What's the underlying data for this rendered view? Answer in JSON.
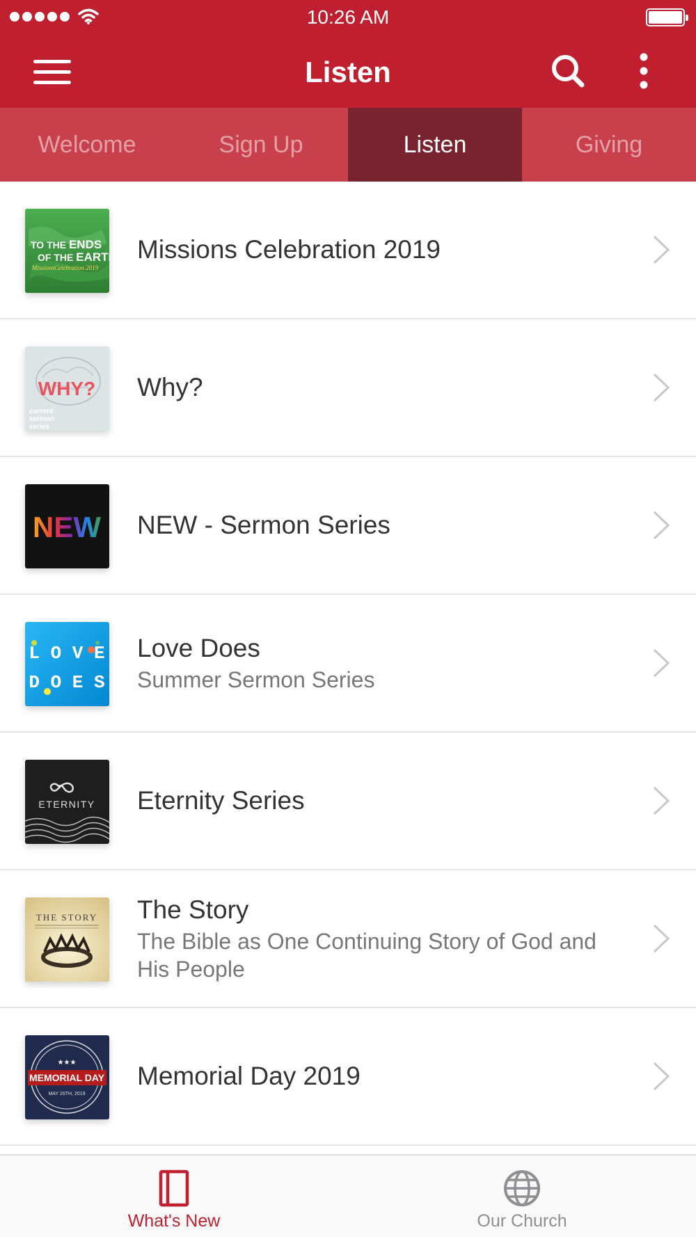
{
  "status_bar": {
    "time": "10:26 AM"
  },
  "nav": {
    "title": "Listen"
  },
  "tabs": [
    {
      "label": "Welcome",
      "active": false
    },
    {
      "label": "Sign Up",
      "active": false
    },
    {
      "label": "Listen",
      "active": true
    },
    {
      "label": "Giving",
      "active": false
    }
  ],
  "items": [
    {
      "title": "Missions Celebration 2019",
      "subtitle": "",
      "thumb_text": {
        "line1": "TO THE ",
        "line1b": "ENDS",
        "line2": "OF THE ",
        "line2b": "EARTH",
        "line3": "MissionsCelebration 2019"
      }
    },
    {
      "title": "Why?",
      "subtitle": "",
      "thumb_text": {
        "line1": "WHY?",
        "line2": "current",
        "line3": "sermon",
        "line4": "series"
      }
    },
    {
      "title": "NEW - Sermon Series",
      "subtitle": "",
      "thumb_text": {
        "line1": "NEW"
      }
    },
    {
      "title": "Love Does",
      "subtitle": "Summer Sermon Series",
      "thumb_text": {
        "line1": "L O V E",
        "line2": "D O E S"
      }
    },
    {
      "title": "Eternity Series",
      "subtitle": "",
      "thumb_text": {
        "line1": "ETERNITY"
      }
    },
    {
      "title": "The Story",
      "subtitle": "The Bible as One Continuing Story of God and His People",
      "thumb_text": {
        "line1": "THE STORY"
      }
    },
    {
      "title": "Memorial Day 2019",
      "subtitle": "",
      "thumb_text": {
        "line1": "MEMORIAL DAY",
        "line2": "MAY 26TH, 2019"
      }
    }
  ],
  "tabbar": [
    {
      "label": "What's New",
      "icon": "book-icon",
      "active": true
    },
    {
      "label": "Our Church",
      "icon": "globe-icon",
      "active": false
    }
  ],
  "colors": {
    "brand_red": "#c01f2f",
    "tab_strip": "#c8404c",
    "tab_active": "#7a2330",
    "tabbar_active": "#c01f2f",
    "tabbar_inactive": "#8e8e93"
  }
}
